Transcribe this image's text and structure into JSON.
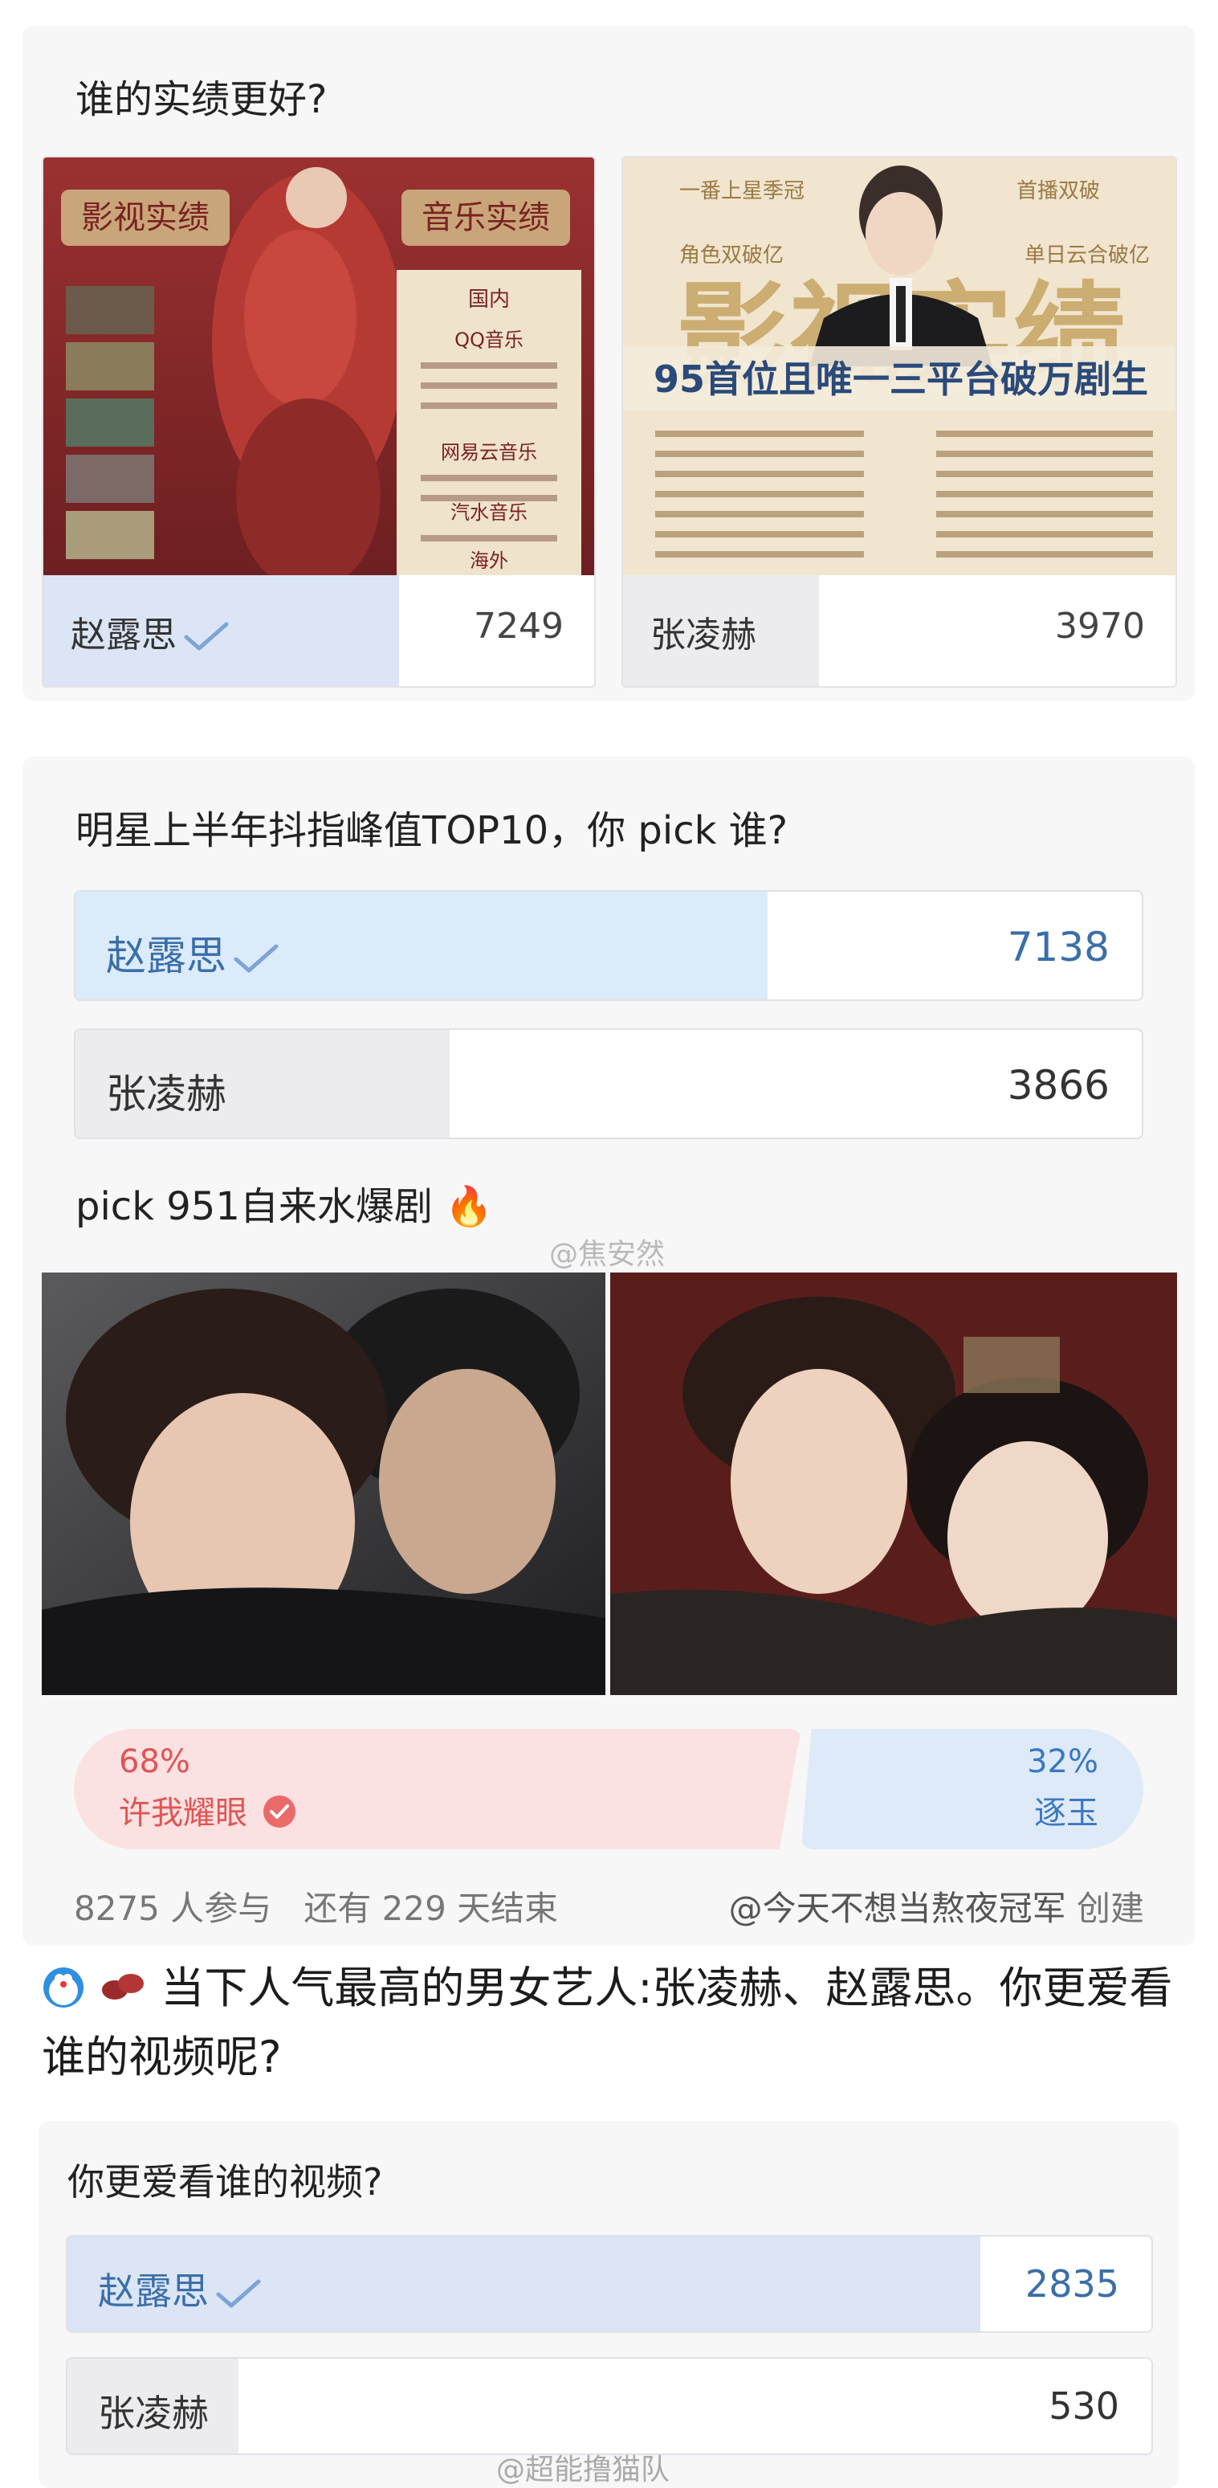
{
  "poll1": {
    "title": "谁的实绩更好?",
    "options": [
      {
        "name": "赵露思",
        "count": "7249",
        "selected": true,
        "share": 0.646,
        "poster": {
          "left_header": "影视实绩",
          "right_header": "音乐实绩",
          "domestic": "国内",
          "services": [
            "QQ音乐",
            "网易云音乐",
            "汽水音乐"
          ],
          "abroad": "海外"
        }
      },
      {
        "name": "张凌赫",
        "count": "3970",
        "selected": false,
        "share": 0.354,
        "poster": {
          "top_left": "一番上星季冠",
          "top_right": "首播双破",
          "banner_left": "角色双破亿",
          "banner_right": "单日云合破亿",
          "headline": "影视实绩",
          "subheadline": "95首位且唯一三平台破万剧生"
        }
      }
    ]
  },
  "poll2": {
    "title": "明星上半年抖指峰值TOP10，你 pick 谁?",
    "options": [
      {
        "name": "赵露思",
        "count": "7138",
        "selected": true,
        "share": 0.649
      },
      {
        "name": "张凌赫",
        "count": "3866",
        "selected": false,
        "share": 0.351
      }
    ]
  },
  "poll3": {
    "title": "pick 951自来水爆剧",
    "flame": "🔥",
    "watermark": "@焦安然",
    "left": {
      "percent": "68%",
      "name": "许我耀眼",
      "share": 0.68,
      "color": "#e05555"
    },
    "right": {
      "percent": "32%",
      "name": "逐玉",
      "share": 0.32,
      "color": "#3a78c2"
    },
    "participants": "8275 人参与",
    "remaining": "还有 229 天结束",
    "creator": "@今天不想当熬夜冠军",
    "created": "创建"
  },
  "post": {
    "text": "当下人气最高的男女艺人:张凌赫、赵露思。你更爱看谁的视频呢?"
  },
  "poll4": {
    "title": "你更爱看谁的视频?",
    "options": [
      {
        "name": "赵露思",
        "count": "2835",
        "selected": true,
        "share": 0.842
      },
      {
        "name": "张凌赫",
        "count": "530",
        "selected": false,
        "share": 0.158
      }
    ],
    "watermark": "@超能撸猫队"
  },
  "colors": {
    "selected_fill": "#dbe5f5",
    "unselected_fill": "#ececee",
    "bar_selected_fill": "#dcebfa",
    "accent": "#3a6ea8"
  }
}
